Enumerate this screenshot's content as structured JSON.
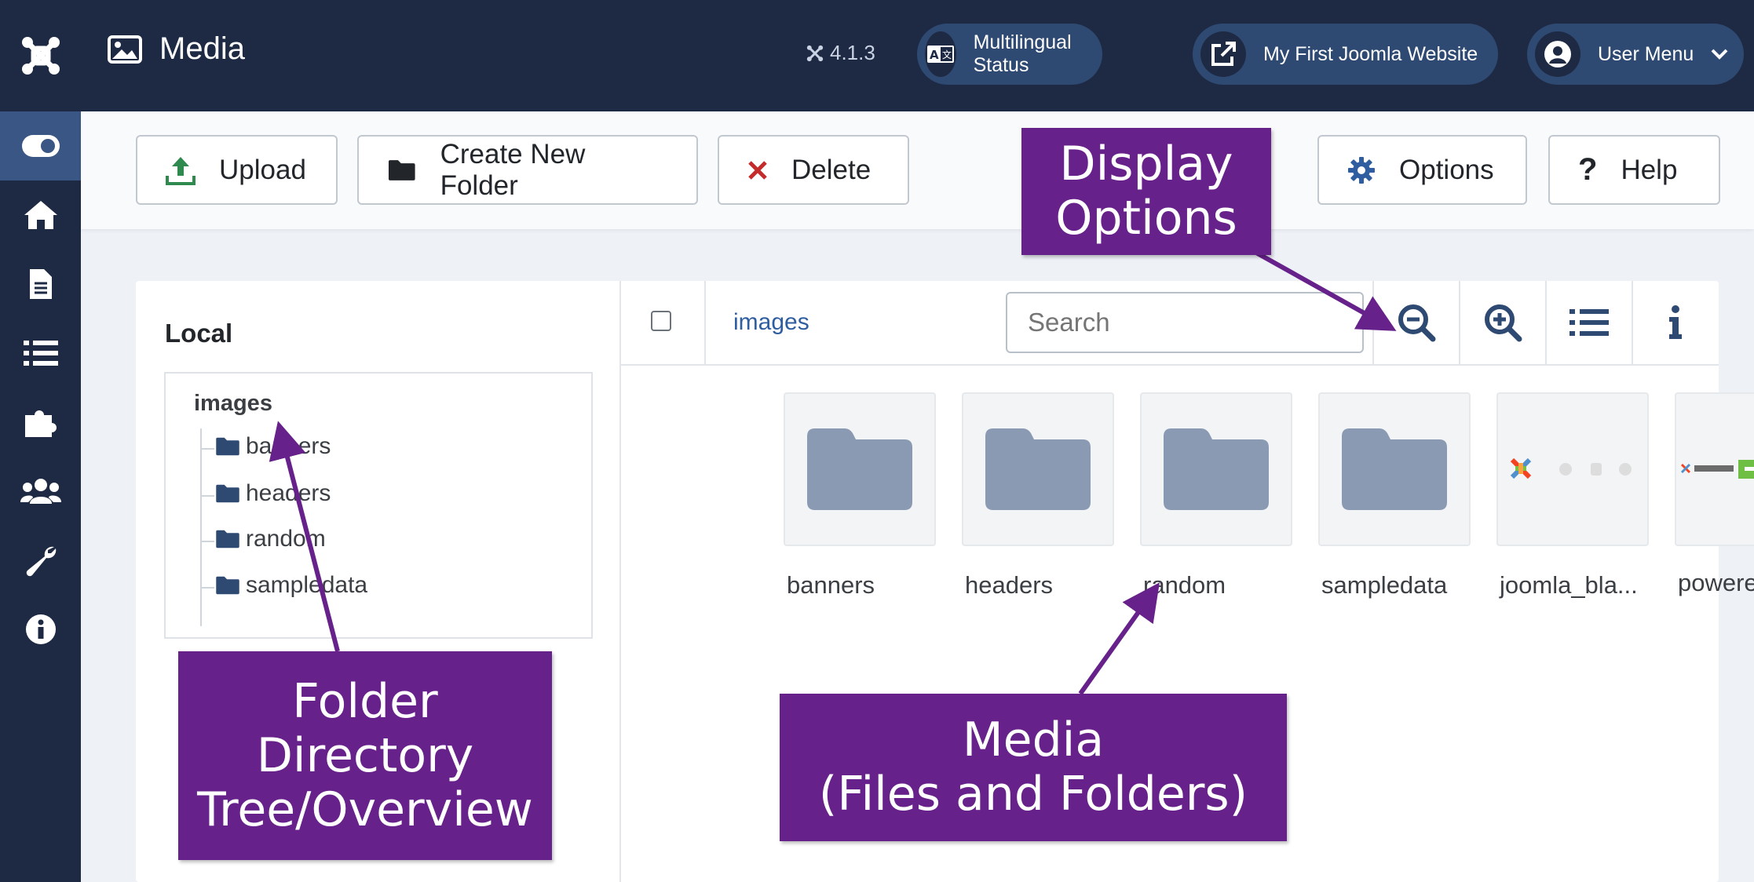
{
  "header": {
    "title": "Media",
    "version": "4.1.3",
    "multilingual_label": "Multilingual Status",
    "site_label": "My First Joomla Website",
    "user_menu_label": "User Menu"
  },
  "sidebar": {
    "items": [
      {
        "icon": "toggle-icon",
        "active": true
      },
      {
        "icon": "home-icon"
      },
      {
        "icon": "document-icon"
      },
      {
        "icon": "list-icon"
      },
      {
        "icon": "puzzle-icon"
      },
      {
        "icon": "users-icon"
      },
      {
        "icon": "wrench-icon"
      },
      {
        "icon": "info-icon"
      }
    ]
  },
  "toolbar": {
    "upload_label": "Upload",
    "new_folder_label": "Create New Folder",
    "delete_label": "Delete",
    "options_label": "Options",
    "help_label": "Help"
  },
  "tree": {
    "title": "Local",
    "root": "images",
    "folders": [
      "banners",
      "headers",
      "random",
      "sampledata"
    ]
  },
  "browser": {
    "breadcrumb": "images",
    "search_placeholder": "Search",
    "items": [
      {
        "name": "banners",
        "type": "folder"
      },
      {
        "name": "headers",
        "type": "folder"
      },
      {
        "name": "random",
        "type": "folder"
      },
      {
        "name": "sampledata",
        "type": "folder"
      },
      {
        "name": "joomla_bla...",
        "type": "image"
      },
      {
        "name": "powered_b...",
        "type": "image"
      }
    ]
  },
  "annotations": {
    "display_options": [
      "Display",
      "Options"
    ],
    "folder_tree": [
      "Folder",
      "Directory",
      "Tree/Overview"
    ],
    "media": [
      "Media",
      "(Files and Folders)"
    ]
  },
  "colors": {
    "sidebar": "#1e2a44",
    "active": "#3a5684",
    "callout": "#67218a",
    "folder": "#8a9ab3",
    "link": "#2f5ea0"
  }
}
